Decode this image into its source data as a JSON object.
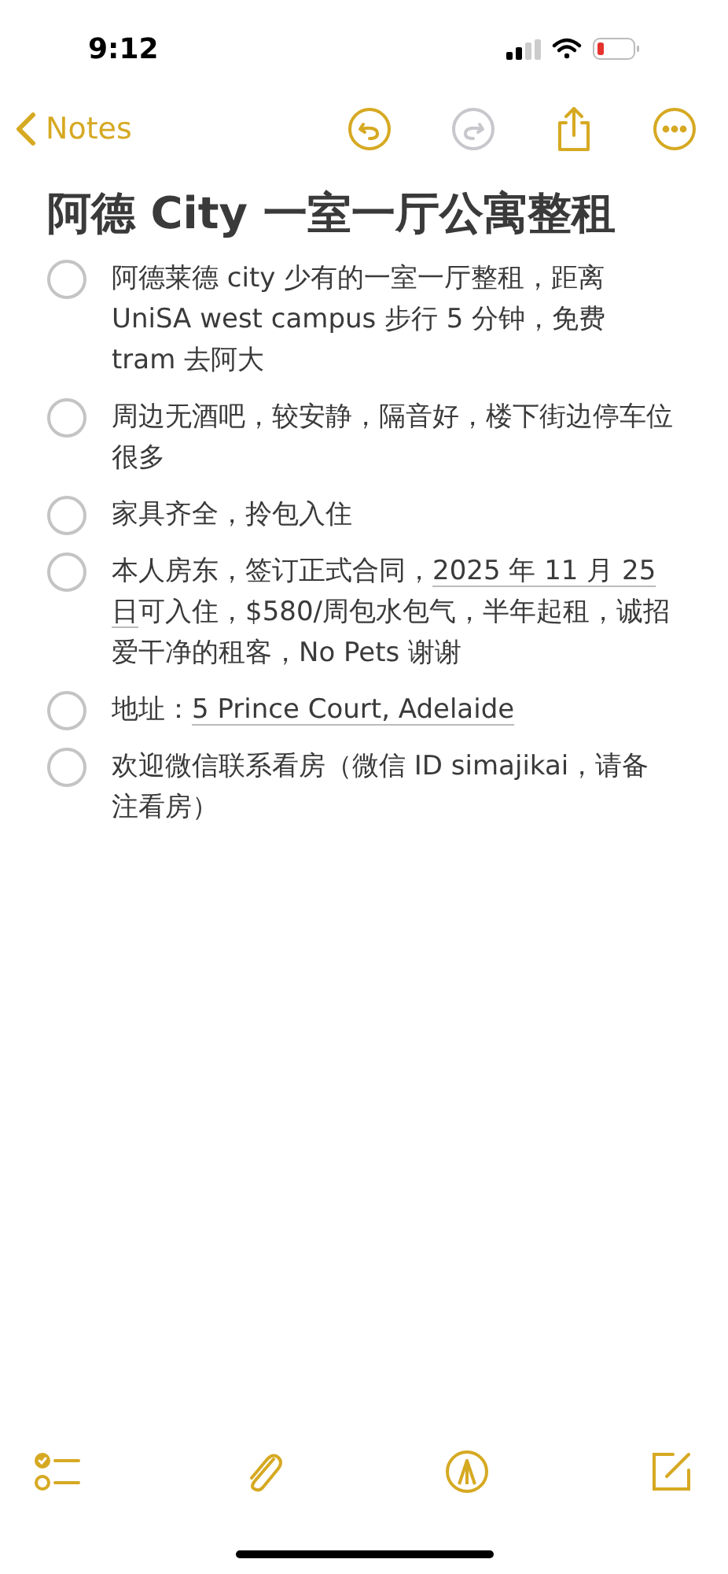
{
  "status_bar": {
    "time": "9:12"
  },
  "nav": {
    "back_label": "Notes",
    "undo": {
      "disabled": false
    },
    "redo": {
      "disabled": true
    }
  },
  "note": {
    "title": "阿德 City 一室一厅公寓整租",
    "items": [
      {
        "checked": false,
        "segments": [
          {
            "text": "阿德莱德 city 少有的一室一厅整租，距离 UniSA west campus 步行 5 分钟，免费 tram 去阿大",
            "underlined": false
          }
        ]
      },
      {
        "checked": false,
        "segments": [
          {
            "text": "周边无酒吧，较安静，隔音好，楼下街边停车位很多",
            "underlined": false
          }
        ]
      },
      {
        "checked": false,
        "segments": [
          {
            "text": "家具齐全，拎包入住",
            "underlined": false
          }
        ]
      },
      {
        "checked": false,
        "segments": [
          {
            "text": "本人房东，签订正式合同，",
            "underlined": false
          },
          {
            "text": "2025 年 11 月 25 日",
            "underlined": true
          },
          {
            "text": "可入住，$580/周包水包气，半年起租，诚招爱干净的租客，No Pets 谢谢",
            "underlined": false
          }
        ]
      },
      {
        "checked": false,
        "segments": [
          {
            "text": "地址：",
            "underlined": false
          },
          {
            "text": "5 Prince Court, Adelaide",
            "underlined": true
          }
        ]
      },
      {
        "checked": false,
        "segments": [
          {
            "text": "欢迎微信联系看房（微信 ID simajikai，请备注看房）",
            "underlined": false
          }
        ]
      }
    ]
  }
}
